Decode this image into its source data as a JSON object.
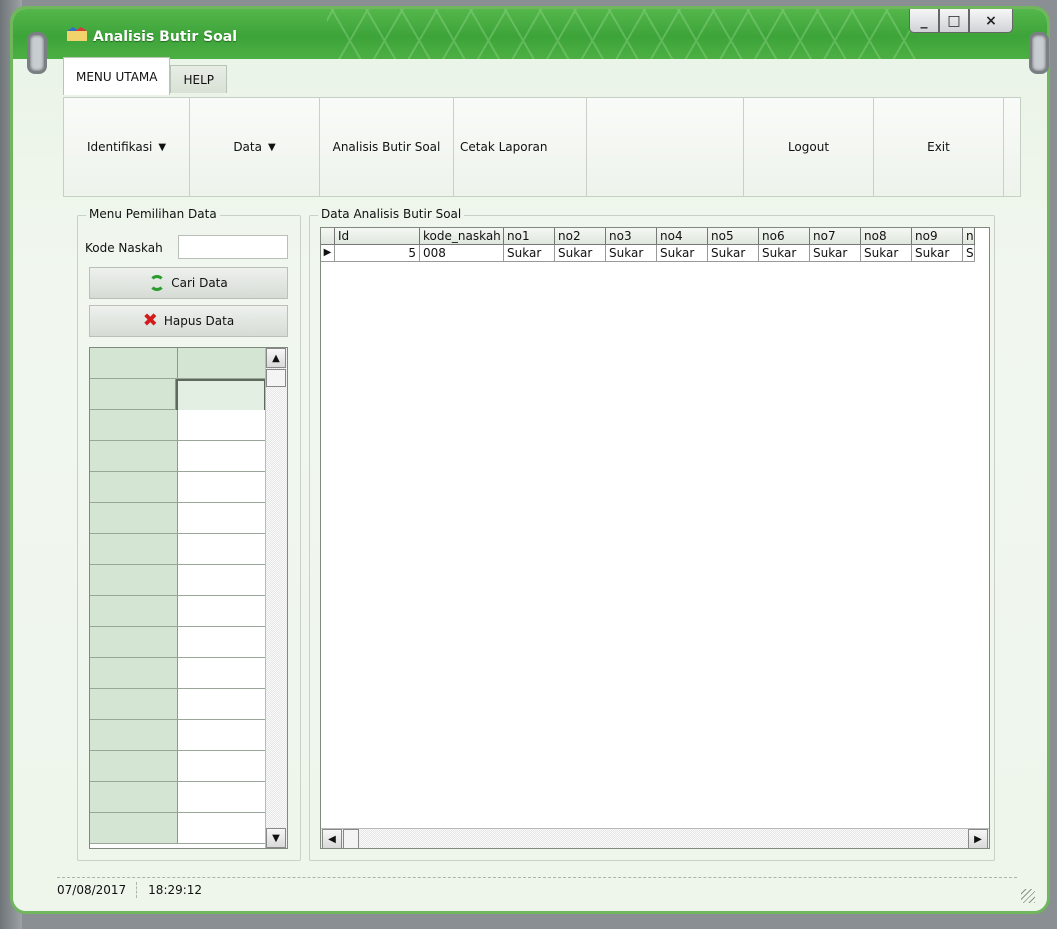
{
  "window": {
    "title": "Analisis Butir Soal"
  },
  "titlebar": {
    "minimize": "_",
    "maximize": "□",
    "close": "×"
  },
  "tabs": [
    {
      "label": "MENU UTAMA",
      "active": true
    },
    {
      "label": "HELP",
      "active": false
    }
  ],
  "ribbon": {
    "identifikasi": "Identifikasi",
    "data": "Data",
    "analisis": "Analisis Butir Soal",
    "cetak": "Cetak Laporan",
    "logout": "Logout",
    "exit": "Exit"
  },
  "left_panel": {
    "title": "Menu Pemilihan Data",
    "kode_label": "Kode Naskah",
    "kode_value": "",
    "cari_button": "Cari Data",
    "hapus_button": "Hapus Data"
  },
  "right_panel": {
    "title": "Data Analisis Butir Soal",
    "columns": [
      "Id",
      "kode_naskah",
      "no1",
      "no2",
      "no3",
      "no4",
      "no5",
      "no6",
      "no7",
      "no8",
      "no9",
      "n"
    ],
    "rows": [
      [
        "5",
        "008",
        "Sukar",
        "Sukar",
        "Sukar",
        "Sukar",
        "Sukar",
        "Sukar",
        "Sukar",
        "Sukar",
        "Sukar",
        "S"
      ]
    ]
  },
  "status": {
    "date": "07/08/2017",
    "time": "18:29:12"
  },
  "colors": {
    "titlebar": "#3da43a",
    "close_accent": "#d41b1b",
    "refresh": "#2a9c2d"
  }
}
